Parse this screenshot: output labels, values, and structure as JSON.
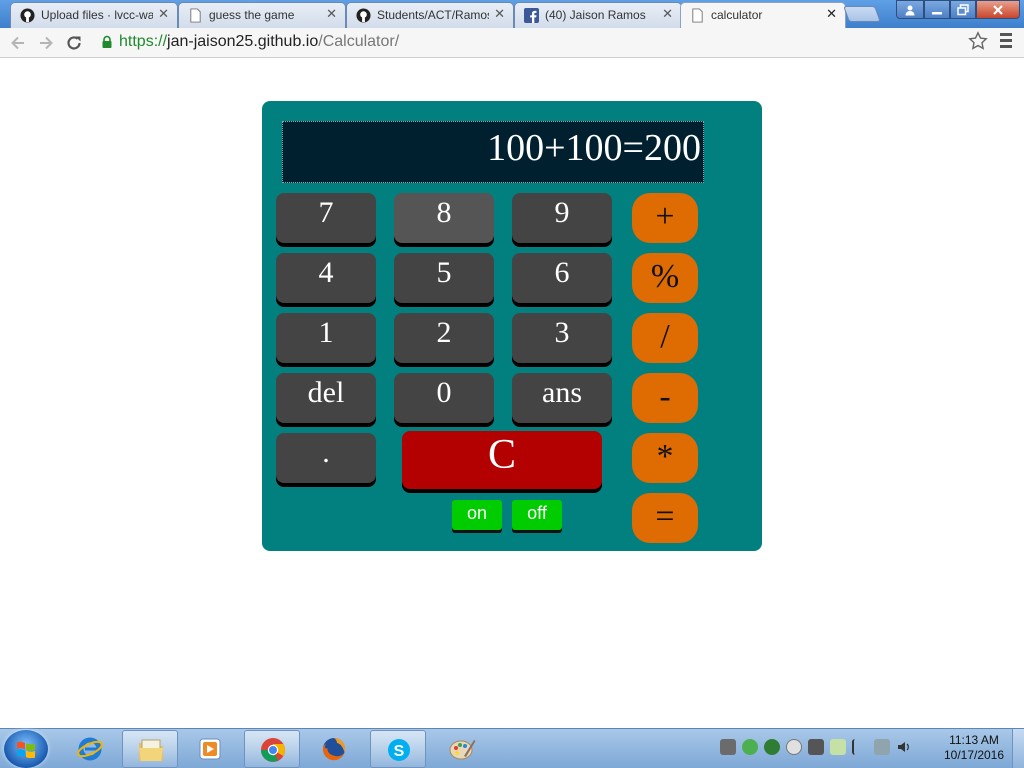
{
  "browser": {
    "tabs": [
      {
        "title": "Upload files · lvcc-wa",
        "icon": "github-icon"
      },
      {
        "title": "guess the game",
        "icon": "page-icon"
      },
      {
        "title": "Students/ACT/Ramos",
        "icon": "github-icon"
      },
      {
        "title": "(40) Jaison Ramos",
        "icon": "facebook-icon"
      },
      {
        "title": "calculator",
        "icon": "page-icon",
        "active": true
      }
    ],
    "close_glyph": "✕",
    "url": {
      "protocol": "https://",
      "host": "jan-jaison25.github.io",
      "path": "/Calculator/"
    }
  },
  "calculator": {
    "display": "100+100=200",
    "keys": {
      "k7": "7",
      "k8": "8",
      "k9": "9",
      "k4": "4",
      "k5": "5",
      "k6": "6",
      "k1": "1",
      "k2": "2",
      "k3": "3",
      "del": "del",
      "k0": "0",
      "ans": "ans",
      "dot": "."
    },
    "operators": {
      "plus": "+",
      "percent": "%",
      "divide": "/",
      "minus": "-",
      "multiply": "*",
      "equals": "="
    },
    "clear": "C",
    "power": {
      "on": "on",
      "off": "off"
    },
    "colors": {
      "body": "#027f7f",
      "display": "#002030",
      "key": "#444444",
      "operator": "#df6c03",
      "clear": "#b30000",
      "power": "#00cc00"
    }
  },
  "taskbar": {
    "apps": [
      "internet-explorer-icon",
      "file-explorer-icon",
      "media-player-icon",
      "chrome-icon",
      "firefox-icon",
      "skype-icon",
      "paint-icon"
    ],
    "clock": {
      "time": "11:13 AM",
      "date": "10/17/2016"
    }
  }
}
